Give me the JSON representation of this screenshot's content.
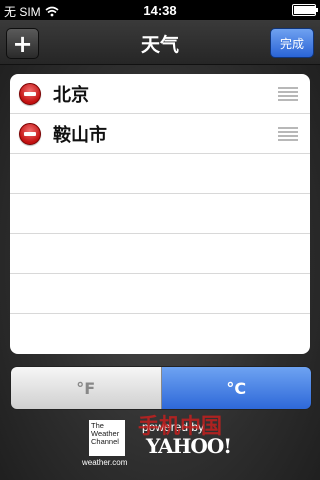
{
  "status_bar": {
    "carrier": "无 SIM",
    "wifi_icon": "wifi-icon",
    "time": "14:38",
    "battery_icon": "battery-icon",
    "battery_level": 1.0
  },
  "nav": {
    "add_label": "+",
    "title": "天气",
    "done_label": "完成"
  },
  "cities": [
    {
      "name": "北京"
    },
    {
      "name": "鞍山市"
    }
  ],
  "units": {
    "fahrenheit_label": "°F",
    "celsius_label": "°C",
    "selected": "°C"
  },
  "footer": {
    "twc_logo_text": "The Weather Channel",
    "twc_url": "weather.com",
    "powered_by": "powered by",
    "yahoo_logo": "YAHOO!",
    "watermark": "手机中国"
  },
  "colors": {
    "accent_blue": "#2e68d8",
    "delete_red": "#c21010"
  }
}
